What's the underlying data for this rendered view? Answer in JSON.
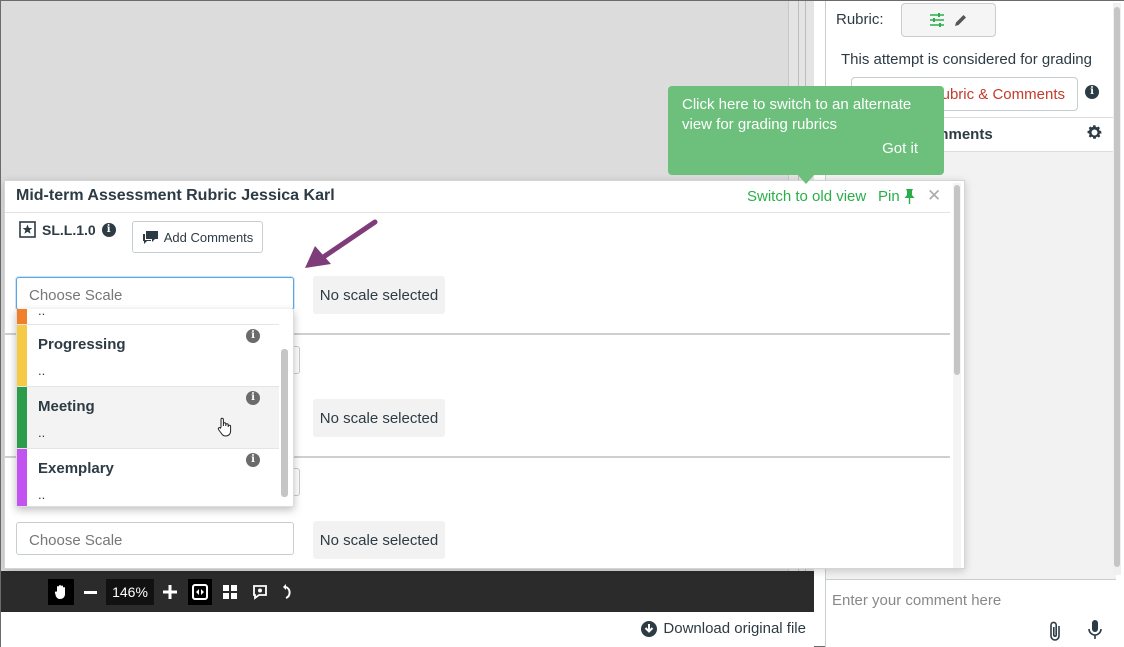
{
  "icons": {
    "rubric_settings": "sliders-icon",
    "rubric_edit": "pencil-icon",
    "info": "info-icon",
    "gear": "gear-icon",
    "clip": "paperclip-icon",
    "mic": "microphone-icon",
    "pin": "pin-icon",
    "close": "close-icon",
    "criterion": "star-box-icon",
    "comment": "speech-bubble-icon",
    "download": "download-icon",
    "hand": "hand-tool-icon",
    "zoom_out": "minus-icon",
    "zoom_in": "plus-icon",
    "fit": "fit-width-icon",
    "grid": "thumbnails-icon",
    "annotate": "annotate-icon",
    "rotate": "rotate-icon",
    "cursor": "pointer-hand-icon",
    "arrow": "annotation-arrow"
  },
  "colors": {
    "green": "#2bae4a",
    "tooltip_bg": "#6cc07b",
    "red_link": "#c23c2d",
    "arrow": "#7e3d7a",
    "levels": {
      "beginning": "#f07f2b",
      "progressing": "#f6c947",
      "meeting": "#2d9c4a",
      "exemplary": "#c253f0"
    }
  },
  "right_panel": {
    "rubric_label": "Rubric:",
    "attempt_text": "This attempt is considered for grading",
    "rubric_comments_button": "ubric & Comments",
    "comments_header": "omments",
    "comment_placeholder": "Enter your comment here"
  },
  "tooltip": {
    "text": "Click here to switch to an alternate view for grading rubrics",
    "got_it": "Got it"
  },
  "modal": {
    "title": "Mid-term Assessment Rubric Jessica Karl",
    "switch_link": "Switch to old view",
    "pin_label": "Pin",
    "criterion_code": "SL.L.1.0",
    "add_comments": "Add Comments",
    "choose_scale_placeholder": "Choose Scale",
    "no_scale": "No scale selected"
  },
  "dropdown": {
    "options": [
      {
        "label": "",
        "sub": ".."
      },
      {
        "label": "Progressing",
        "sub": ".."
      },
      {
        "label": "Meeting",
        "sub": ".."
      },
      {
        "label": "Exemplary",
        "sub": ".."
      }
    ]
  },
  "toolbar": {
    "zoom": "146%"
  },
  "download": {
    "label": "Download original file"
  }
}
